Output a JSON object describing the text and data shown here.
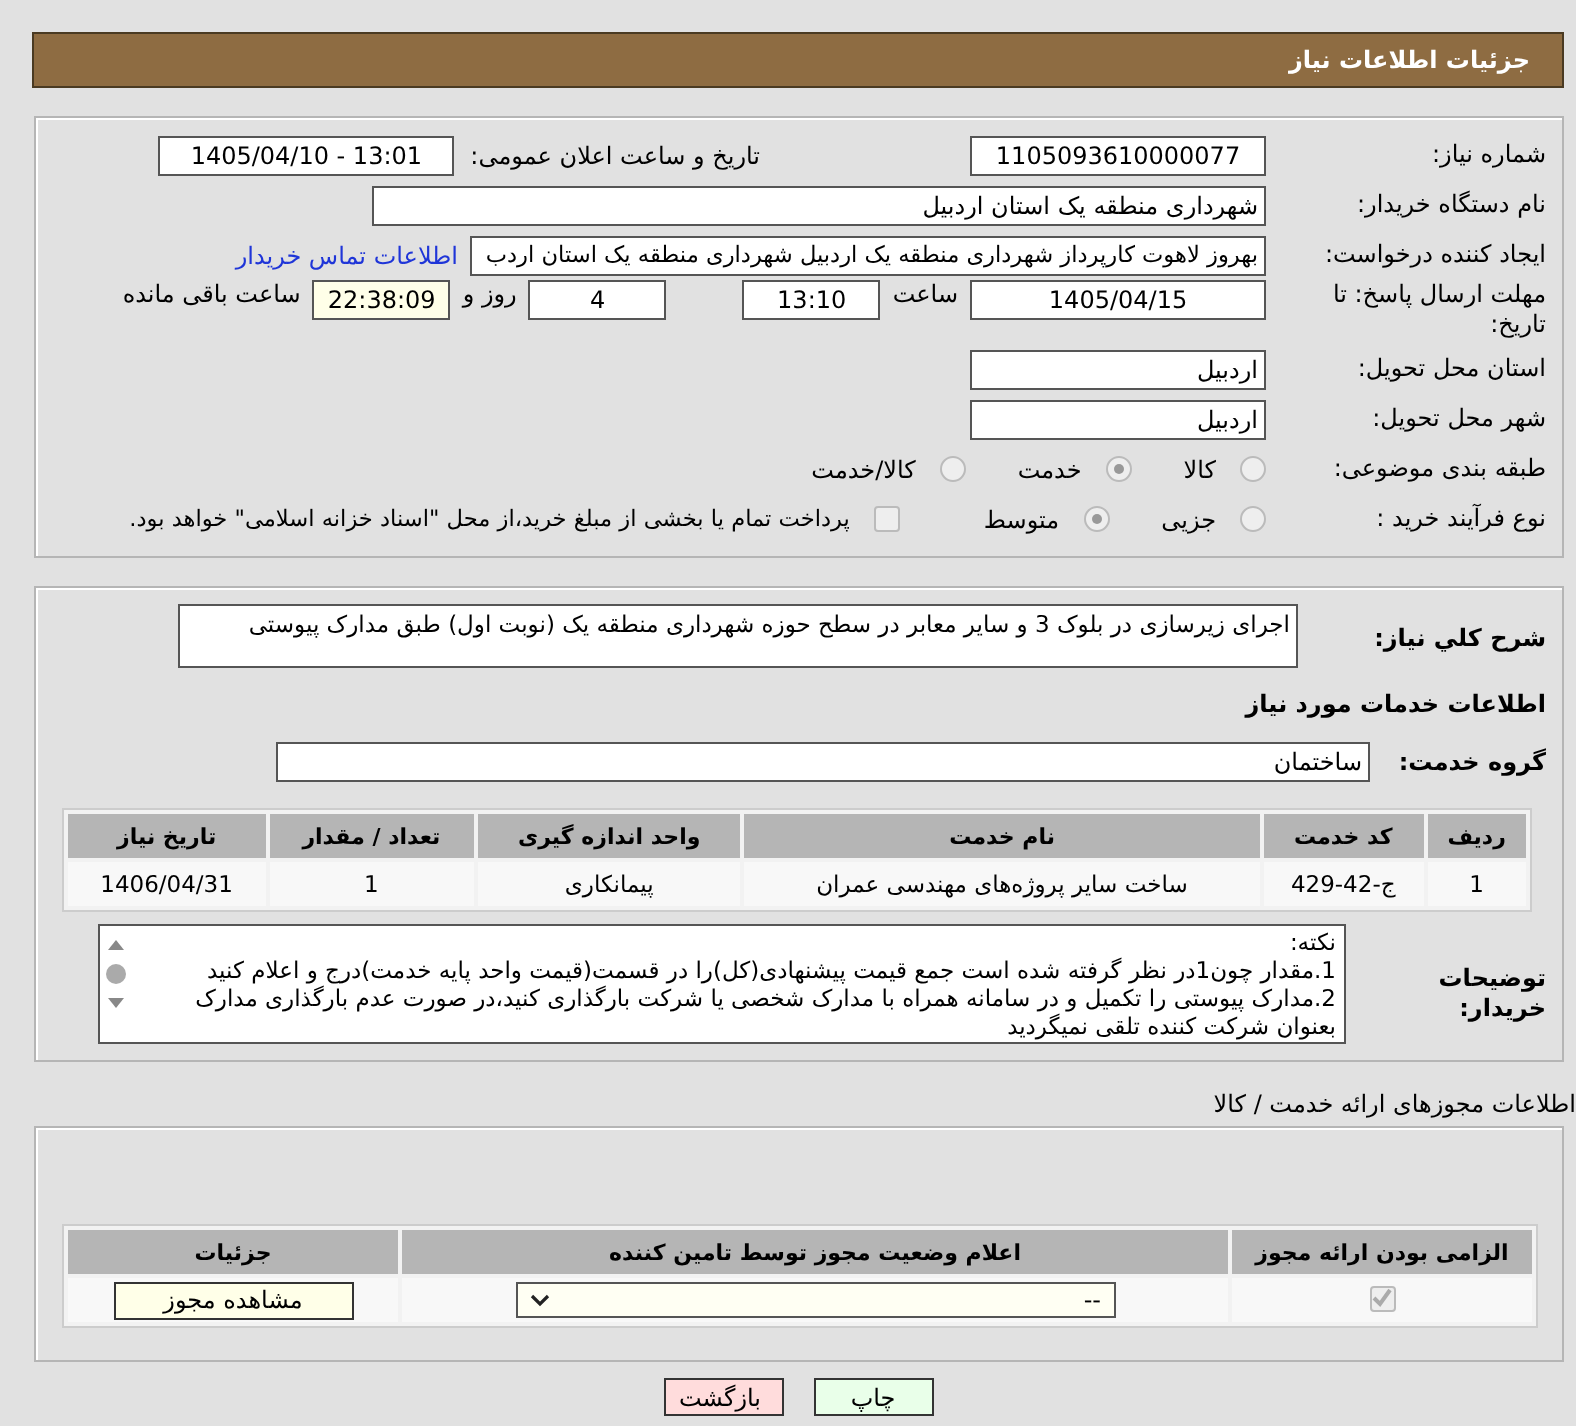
{
  "header": {
    "title": "جزئیات اطلاعات نیاز"
  },
  "form": {
    "need_number": {
      "label": "شماره نیاز:",
      "value": "1105093610000077"
    },
    "announce": {
      "label": "تاریخ و ساعت اعلان عمومی:",
      "value": "1405/04/10 - 13:01"
    },
    "buyer": {
      "label": "نام دستگاه خریدار:",
      "value": "شهرداری منطقه یک استان اردبیل"
    },
    "creator": {
      "label": "ایجاد کننده درخواست:",
      "value": "بهروز لاهوت کارپرداز شهرداری منطقه یک اردبیل شهرداری منطقه یک استان اردب",
      "link": "اطلاعات تماس خریدار"
    },
    "deadline": {
      "label": "مهلت ارسال پاسخ: تا تاریخ:",
      "date": "1405/04/15",
      "time_label": "ساعت",
      "time": "13:10",
      "days": "4",
      "days_label": "روز و",
      "remaining": "22:38:09",
      "remaining_label": "ساعت باقی مانده"
    },
    "province": {
      "label": "استان محل تحویل:",
      "value": "اردبیل"
    },
    "city": {
      "label": "شهر محل تحویل:",
      "value": "اردبیل"
    },
    "category": {
      "label": "طبقه بندی موضوعی:",
      "options": [
        {
          "label": "کالا",
          "selected": false
        },
        {
          "label": "خدمت",
          "selected": true
        },
        {
          "label": "کالا/خدمت",
          "selected": false
        }
      ]
    },
    "process": {
      "label": "نوع فرآیند خرید :",
      "options": [
        {
          "label": "جزیی",
          "selected": false
        },
        {
          "label": "متوسط",
          "selected": true
        }
      ],
      "payment": {
        "label": "پرداخت تمام یا بخشی از مبلغ خرید،از محل \"اسناد خزانه اسلامی\" خواهد بود.",
        "checked": false
      }
    }
  },
  "details": {
    "description": {
      "label": "شرح کلي نیاز:",
      "value": "اجرای زیرسازی در بلوک 3 و سایر معابر در سطح حوزه شهرداری منطقه یک (نوبت اول) طبق مدارک پیوستی"
    },
    "heading": "اطلاعات خدمات مورد نیاز",
    "group": {
      "label": "گروه خدمت:",
      "value": "ساختمان"
    },
    "table": {
      "columns": [
        "ردیف",
        "کد خدمت",
        "نام خدمت",
        "واحد اندازه گیری",
        "تعداد / مقدار",
        "تاریخ نیاز"
      ],
      "rows": [
        [
          "1",
          "ج-42-429",
          "ساخت سایر پروژه‌های مهندسی عمران",
          "پیمانکاری",
          "1",
          "1406/04/31"
        ]
      ]
    },
    "notes": {
      "label": "توضیحات خریدار:",
      "lines": [
        "نکته:",
        "1.مقدار چون1در نظر گرفته شده است جمع قیمت پیشنهادی(کل)را در قسمت(قیمت واحد پایه خدمت)درج و اعلام کنید",
        "2.مدارک پیوستی را تکمیل و در سامانه همراه با مدارک شخصی یا شرکت بارگذاری کنید،در صورت عدم بارگذاری مدارک بعنوان شرکت کننده تلقی نمیگردید"
      ]
    }
  },
  "licenses": {
    "title": "اطلاعات مجوزهای ارائه خدمت / کالا",
    "columns": [
      "الزامی بودن ارائه مجوز",
      "اعلام وضعیت مجوز توسط تامین کننده",
      "جزئیات"
    ],
    "rows": [
      {
        "required": true,
        "status": "--",
        "action": "مشاهده مجوز"
      }
    ]
  },
  "buttons": [
    {
      "kind": "print",
      "label": "چاپ"
    },
    {
      "kind": "back",
      "label": "بازگشت"
    }
  ]
}
